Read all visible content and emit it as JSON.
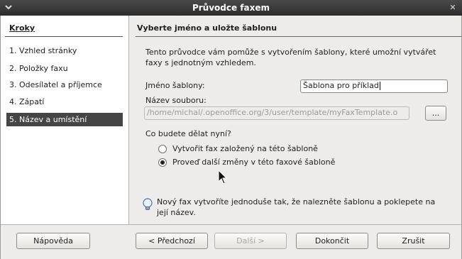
{
  "window": {
    "title": "Průvodce faxem",
    "menu_icon": "window-menu-icon",
    "close_glyph": "✕"
  },
  "sidebar": {
    "heading": "Kroky",
    "steps": [
      "1. Vzhled stránky",
      "2. Položky faxu",
      "3. Odesílatel a příjemce",
      "4. Zápatí",
      "5. Název a umístění"
    ],
    "active_index": 4
  },
  "main": {
    "heading": "Vyberte jméno a uložte šablonu",
    "intro": "Tento průvodce vám pomůže s vytvořením šablony, které umožní vytvářet faxy s jednotným vzhledem.",
    "template_name_label": "Jméno šablony:",
    "template_name_value": "Šablona pro příklad",
    "file_name_label": "Název souboru:",
    "file_name_value": "/home/michal/.openoffice.org/3/user/template/myFaxTemplate.o",
    "browse_label": "...",
    "question": "Co budete dělat nyní?",
    "options": [
      {
        "label": "Vytvořit fax založený na této šabloně",
        "selected": false
      },
      {
        "label": "Proveď další změny v této faxové šabloně",
        "selected": true
      }
    ],
    "hint": "Nový fax vytvoříte jednoduše tak, že nalezněte šablonu a poklepete na její název."
  },
  "buttons": {
    "help": "Nápověda",
    "back": "< Předchozí",
    "next": "Další >",
    "finish": "Dokončit",
    "cancel": "Zrušit"
  }
}
